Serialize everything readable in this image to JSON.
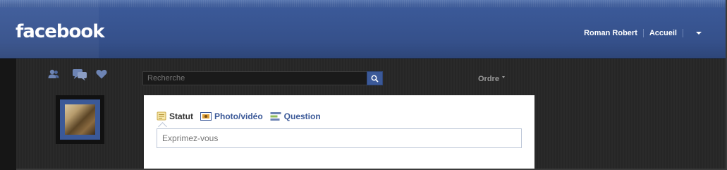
{
  "header": {
    "logo": "facebook",
    "user_name": "Roman Robert",
    "home_label": "Accueil"
  },
  "jewels": {
    "friends": "friends-icon",
    "messages": "messages-icon",
    "notifications": "notifications-icon"
  },
  "search": {
    "placeholder": "Recherche"
  },
  "feed": {
    "sort_label": "Ordre"
  },
  "composer": {
    "tabs": [
      {
        "label": "Statut",
        "icon": "status-icon"
      },
      {
        "label": "Photo/vidéo",
        "icon": "photo-icon"
      },
      {
        "label": "Question",
        "icon": "question-icon"
      }
    ],
    "placeholder": "Exprimez-vous"
  },
  "colors": {
    "brand_blue": "#3b5998",
    "dark_background": "#262626",
    "link_blue": "#3b5998"
  }
}
